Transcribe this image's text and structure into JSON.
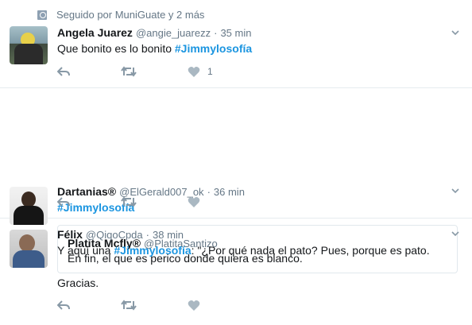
{
  "context": {
    "text": "Seguido por MuniGuate y 2 más",
    "icon": "person-follow-icon"
  },
  "tweets": [
    {
      "fullname": "Angela Juarez",
      "handle": "@angie_juarezz",
      "separator": "·",
      "time": "35 min",
      "text_before": "Que bonito es lo bonito ",
      "hashtag": "#Jimmylosofía",
      "like_count": "1"
    },
    {
      "fullname": "Dartanias®",
      "handle": "@ElGerald007_ok",
      "separator": "·",
      "time": "36 min",
      "hashtag": "#Jimmylosofía",
      "quote": {
        "fullname": "Platita Mcfly®",
        "handle": "@PlatitaSantizo",
        "text": "En fin, el que es perico donde quiera es blanco."
      }
    },
    {
      "fullname": "Félix",
      "handle": "@QiqoCpda",
      "separator": "·",
      "time": "38 min",
      "text_before": "Y aquí una ",
      "hashtag": "#Jimmylosofía",
      "text_after": ": \"¿Por qué nada el pato? Pues, porque es pato.",
      "text_line2": "Gracias."
    }
  ],
  "icons": {
    "reply": "reply-icon",
    "retweet": "retweet-icon",
    "like": "heart-icon",
    "more": "chevron-down-icon"
  },
  "colors": {
    "link": "#1b95e0",
    "muted": "#657786",
    "icon": "#8899a6",
    "border": "#e6ecf0"
  }
}
